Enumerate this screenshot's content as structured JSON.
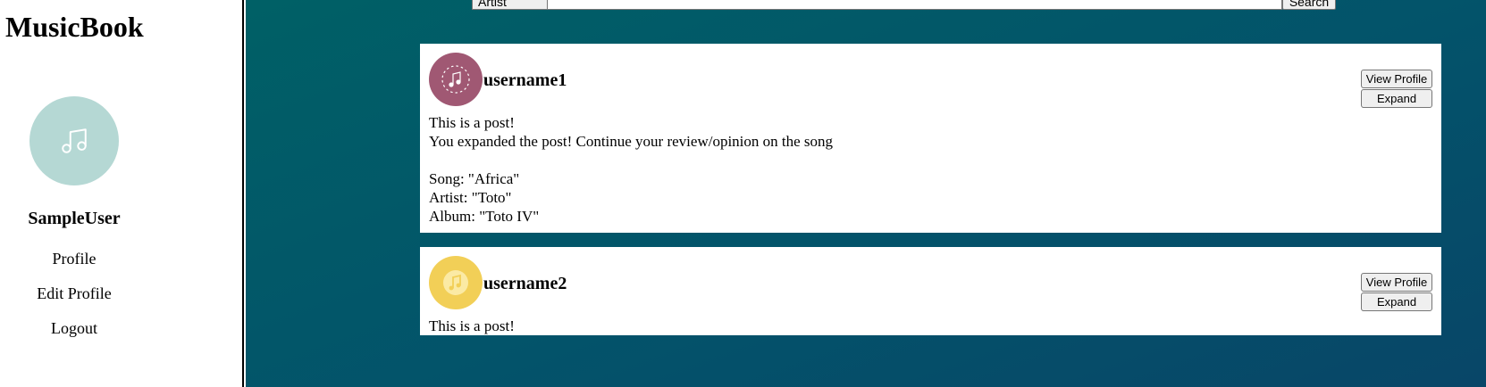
{
  "app": {
    "brand": "MusicBook"
  },
  "colors": {
    "sidebar_avatar": "#b5d8d4",
    "main_gradient_start": "#006066",
    "main_gradient_end": "#084668",
    "post1_avatar": "#a05873",
    "post2_avatar": "#f2cf57"
  },
  "sidebar": {
    "avatar_icon": "music-note-icon",
    "username": "SampleUser",
    "links": [
      {
        "label": "Profile"
      },
      {
        "label": "Edit Profile"
      },
      {
        "label": "Logout"
      }
    ]
  },
  "search": {
    "filter_value": "Artist",
    "button_label": "Search"
  },
  "posts": [
    {
      "username": "username1",
      "avatar_icon": "music-note-icon",
      "view_profile_label": "View Profile",
      "expand_label": "Expand",
      "text": "This is a post!",
      "expanded_text": "You expanded the post! Continue your review/opinion on the song",
      "song": "Song: \"Africa\"",
      "artist": "Artist: \"Toto\"",
      "album": "Album: \"Toto IV\""
    },
    {
      "username": "username2",
      "avatar_icon": "music-note-icon",
      "view_profile_label": "View Profile",
      "expand_label": "Expand",
      "text": "This is a post!"
    }
  ]
}
